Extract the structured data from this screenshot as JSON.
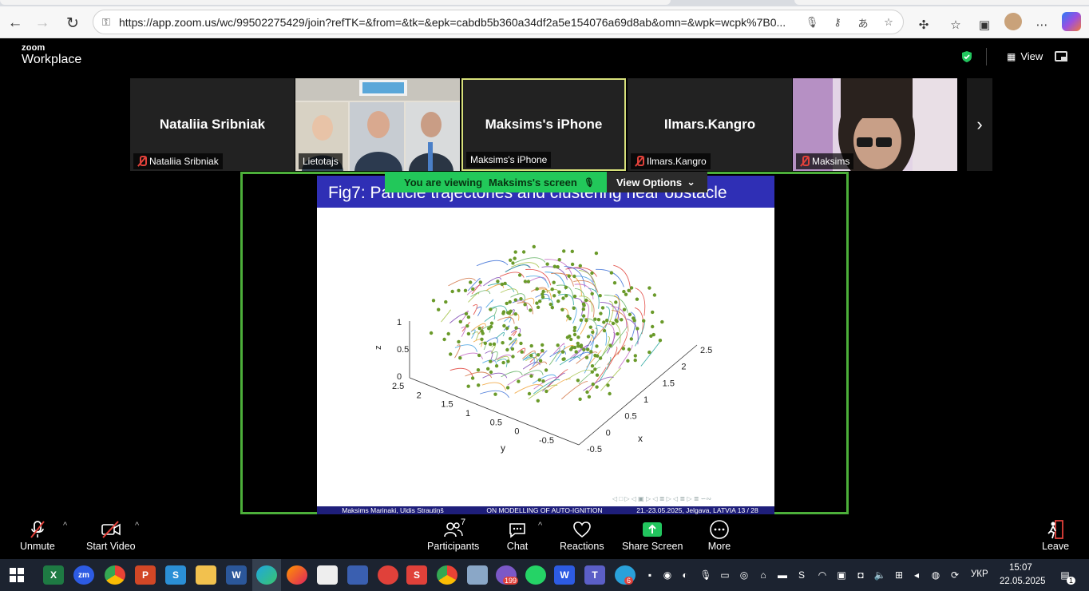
{
  "browser": {
    "url": "https://app.zoom.us/wc/99502275429/join?refTK=&from=&tk=&epk=cabdb5b360a34df2a5e154076a69d8ab&omn=&wpk=wcpk%7B0..."
  },
  "zoom": {
    "brand_small": "zoom",
    "brand_big": "Workplace",
    "view_label": "View",
    "participants_strip": [
      {
        "name": "Nataliia Sribniak",
        "label": "Nataliia Sribniak",
        "muted": true,
        "type": "avatar-name"
      },
      {
        "name": "",
        "label": "Lietotajs",
        "muted": false,
        "type": "video"
      },
      {
        "name": "Maksims's iPhone",
        "label": "Maksims's iPhone",
        "muted": false,
        "type": "avatar-name",
        "active": true
      },
      {
        "name": "Ilmars.Kangro",
        "label": "Ilmars.Kangro",
        "muted": true,
        "type": "avatar-name"
      },
      {
        "name": "",
        "label": "Maksims",
        "muted": true,
        "type": "video"
      }
    ],
    "viewing_banner": {
      "prefix": "You are viewing",
      "who": "Maksims's screen"
    },
    "view_options": "View Options",
    "slide": {
      "title": "Fig7:  Particle trajectories and clustering near obstacle",
      "footer_authors": "Maksims Marinaki, Uldis Strautiņš",
      "footer_title": "ON MODELLING OF AUTO-IGNITION",
      "footer_event": "21.-23.05.2025, Jelgava, LATVIA   13 / 28"
    },
    "toolbar": {
      "unmute": "Unmute",
      "start_video": "Start Video",
      "participants": "Participants",
      "participants_count": "7",
      "chat": "Chat",
      "reactions": "Reactions",
      "share_screen": "Share Screen",
      "more": "More",
      "leave": "Leave"
    }
  },
  "chart_data": {
    "type": "scatter",
    "title": "",
    "xlabel": "x",
    "ylabel": "y",
    "zlabel": "z",
    "x_ticks": [
      "-0.5",
      "0",
      "0.5",
      "1",
      "1.5",
      "2",
      "2.5"
    ],
    "y_ticks": [
      "2.5",
      "2",
      "1.5",
      "1",
      "0.5",
      "0",
      "-0.5"
    ],
    "z_ticks": [
      "0",
      "0.5",
      "1"
    ],
    "xlim": [
      -0.5,
      2.5
    ],
    "ylim": [
      -0.5,
      2.5
    ],
    "zlim": [
      0,
      1
    ],
    "description_color_points": "#6a9a2a"
  },
  "taskbar": {
    "lang": "УКР",
    "time": "15:07",
    "date": "22.05.2025",
    "badges": {
      "viber": "199",
      "telegram": "6",
      "notifications": "1"
    }
  }
}
